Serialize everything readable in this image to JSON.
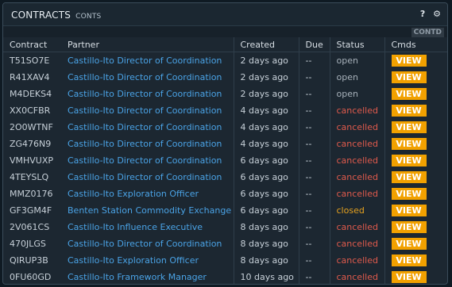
{
  "window": {
    "title": "CONTRACTS",
    "subtitle": "CONTS",
    "help_icon": "?",
    "settings_icon": "gear-icon",
    "contd_tag": "CONTD"
  },
  "table": {
    "headers": [
      "Contract",
      "Partner",
      "Created",
      "Due",
      "Status",
      "Cmds"
    ],
    "rows": [
      {
        "contract": "T51SO7E",
        "partner": "Castillo-Ito Director of Coordination",
        "created": "2 days ago",
        "due": "--",
        "status": "open",
        "cmd": "VIEW"
      },
      {
        "contract": "R41XAV4",
        "partner": "Castillo-Ito Director of Coordination",
        "created": "2 days ago",
        "due": "--",
        "status": "open",
        "cmd": "VIEW"
      },
      {
        "contract": "M4DEKS4",
        "partner": "Castillo-Ito Director of Coordination",
        "created": "2 days ago",
        "due": "--",
        "status": "open",
        "cmd": "VIEW"
      },
      {
        "contract": "XX0CFBR",
        "partner": "Castillo-Ito Director of Coordination",
        "created": "4 days ago",
        "due": "--",
        "status": "cancelled",
        "cmd": "VIEW"
      },
      {
        "contract": "2O0WTNF",
        "partner": "Castillo-Ito Director of Coordination",
        "created": "4 days ago",
        "due": "--",
        "status": "cancelled",
        "cmd": "VIEW"
      },
      {
        "contract": "ZG476N9",
        "partner": "Castillo-Ito Director of Coordination",
        "created": "4 days ago",
        "due": "--",
        "status": "cancelled",
        "cmd": "VIEW"
      },
      {
        "contract": "VMHVUXP",
        "partner": "Castillo-Ito Director of Coordination",
        "created": "6 days ago",
        "due": "--",
        "status": "cancelled",
        "cmd": "VIEW"
      },
      {
        "contract": "4TEYSLQ",
        "partner": "Castillo-Ito Director of Coordination",
        "created": "6 days ago",
        "due": "--",
        "status": "cancelled",
        "cmd": "VIEW"
      },
      {
        "contract": "MMZ0176",
        "partner": "Castillo-Ito Exploration Officer",
        "created": "6 days ago",
        "due": "--",
        "status": "cancelled",
        "cmd": "VIEW"
      },
      {
        "contract": "GF3GM4F",
        "partner": "Benten Station Commodity Exchange",
        "created": "6 days ago",
        "due": "--",
        "status": "closed",
        "cmd": "VIEW"
      },
      {
        "contract": "2V061CS",
        "partner": "Castillo-Ito Influence Executive",
        "created": "8 days ago",
        "due": "--",
        "status": "cancelled",
        "cmd": "VIEW"
      },
      {
        "contract": "470JLGS",
        "partner": "Castillo-Ito Director of Coordination",
        "created": "8 days ago",
        "due": "--",
        "status": "cancelled",
        "cmd": "VIEW"
      },
      {
        "contract": "QIRUP3B",
        "partner": "Castillo-Ito Exploration Officer",
        "created": "8 days ago",
        "due": "--",
        "status": "cancelled",
        "cmd": "VIEW"
      },
      {
        "contract": "0FU60GD",
        "partner": "Castillo-Ito Framework Manager",
        "created": "10 days ago",
        "due": "--",
        "status": "cancelled",
        "cmd": "VIEW"
      }
    ]
  },
  "colors": {
    "open": "#a7b1ba",
    "cancelled": "#e05a4c",
    "closed": "#e6a21e",
    "partner": "#4aa3e6",
    "button": "#f2a100"
  }
}
